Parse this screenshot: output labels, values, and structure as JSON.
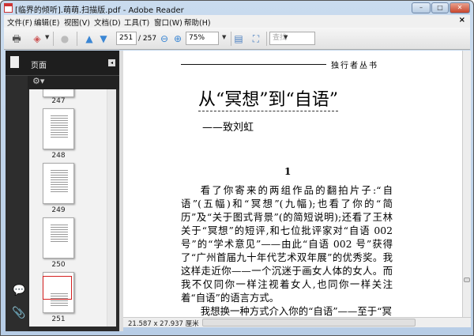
{
  "window": {
    "title": "[临界的倾听].萌萌.扫描版.pdf - Adobe Reader"
  },
  "menu": [
    "文件(F)",
    "编辑(E)",
    "视图(V)",
    "文档(D)",
    "工具(T)",
    "窗口(W)",
    "帮助(H)"
  ],
  "toolbar": {
    "page_current": "251",
    "page_total": "/ 257",
    "zoom": "75%",
    "search_placeholder": "查找"
  },
  "sidebar": {
    "title": "页面",
    "thumbnails": [
      {
        "label": "247"
      },
      {
        "label": "248"
      },
      {
        "label": "249"
      },
      {
        "label": "250"
      },
      {
        "label": "251",
        "selected": true
      }
    ]
  },
  "document": {
    "series": "独行者丛书",
    "title": "从“冥想”到“自语”",
    "subtitle": "——致刘虹",
    "section": "1",
    "paragraph": "看了你寄来的两组作品的翻拍片子:“自语”(五幅)和“冥想”(九幅);也看了你的“简历”及“关于图式背景”(的简短说明);还看了王林关于“冥想”的短评,和七位批评家对“自语 002 号”的“学术意见”——由此“自语 002 号”获得了“广州首届九十年代艺术双年展”的优秀奖。我这样走近你——一个沉迷于画女人体的女人。而我不仅同你一样注视着女人,也同你一样关注着“自语”的语言方式。",
    "next_line": "我想换一种方式介入你的“自语”——至于“冥"
  },
  "status": {
    "page_size": "21.587 x 27.937 厘米"
  },
  "colors": {
    "selected_thumb": "#d42020",
    "panel_bg": "#2a2a2a"
  }
}
